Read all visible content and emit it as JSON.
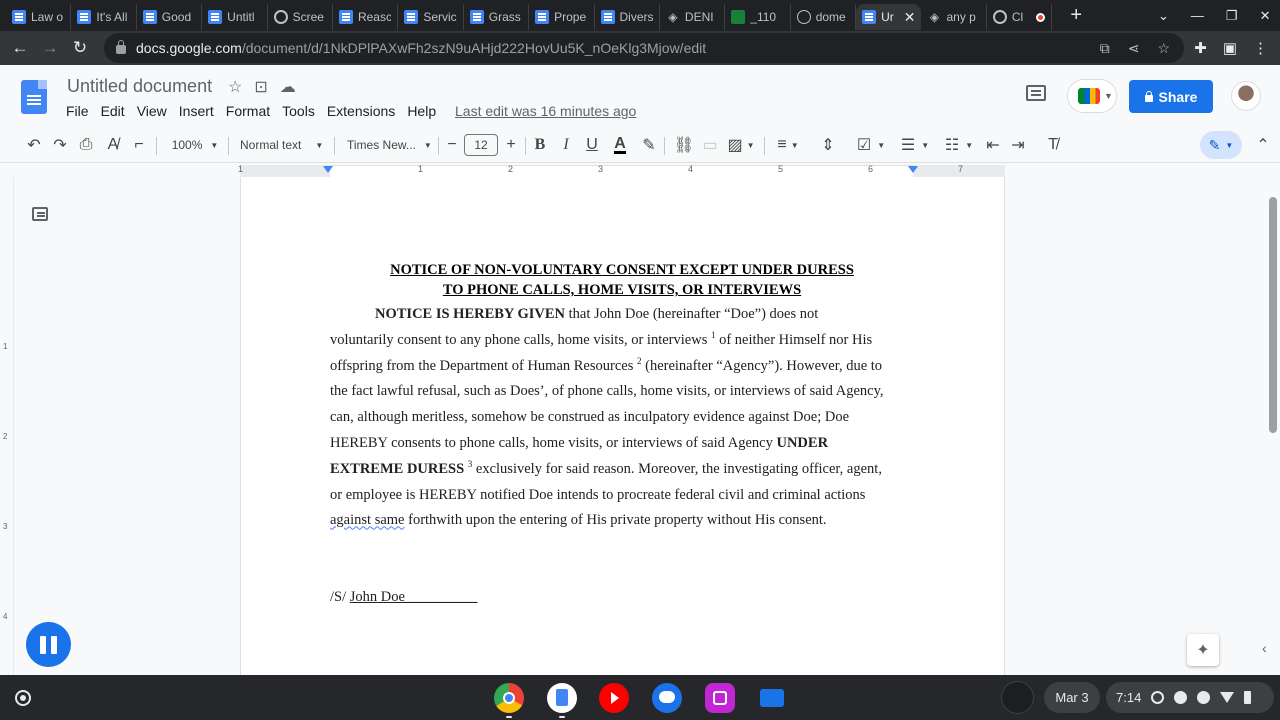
{
  "browser": {
    "tabs": [
      {
        "title": "Law o",
        "favicon": "docs-icon"
      },
      {
        "title": "It's All",
        "favicon": "docs-icon"
      },
      {
        "title": "Good",
        "favicon": "docs-icon"
      },
      {
        "title": "Untitl",
        "favicon": "docs-icon"
      },
      {
        "title": "Scree",
        "favicon": "record-icon"
      },
      {
        "title": "Reasc",
        "favicon": "docs-icon"
      },
      {
        "title": "Servic",
        "favicon": "docs-icon"
      },
      {
        "title": "Grass",
        "favicon": "docs-icon"
      },
      {
        "title": "Prope",
        "favicon": "docs-icon"
      },
      {
        "title": "Divers",
        "favicon": "docs-icon"
      },
      {
        "title": "DENI",
        "favicon": "diamond-icon"
      },
      {
        "title": "_110",
        "favicon": "sheets-icon"
      },
      {
        "title": "dome",
        "favicon": "globe-icon"
      },
      {
        "title": "Ur",
        "favicon": "docs-icon",
        "active": true
      },
      {
        "title": "any p",
        "favicon": "diamond-icon"
      },
      {
        "title": "Cl",
        "favicon": "record-icon"
      }
    ],
    "url_domain": "docs.google.com",
    "url_path": "/document/d/1NkDPlPAXwFh2szN9uAHjd222HovUu5K_nOeKlg3Mjow/edit"
  },
  "docs": {
    "title": "Untitled document",
    "menu": [
      "File",
      "Edit",
      "View",
      "Insert",
      "Format",
      "Tools",
      "Extensions",
      "Help"
    ],
    "last_edit": "Last edit was 16 minutes ago",
    "share_label": "Share",
    "toolbar": {
      "zoom": "100%",
      "style": "Normal text",
      "font": "Times New...",
      "font_size": "12",
      "minus": "−",
      "plus": "+"
    },
    "ruler_numbers": [
      "1",
      "1",
      "2",
      "3",
      "4",
      "5",
      "6",
      "7"
    ],
    "vruler_numbers": [
      "1",
      "2",
      "3",
      "4"
    ]
  },
  "document": {
    "heading_line1": "NOTICE OF NON-VOLUNTARY CONSENT EXCEPT UNDER DURESS",
    "heading_line2": "TO PHONE CALLS, HOME VISITS, OR INTERVIEWS",
    "lines": {
      "l1_bold": "NOTICE IS HEREBY GIVEN",
      "l1_rest": " that John Doe (hereinafter “Doe”) does not",
      "l2_text": "voluntarily consent to any phone calls, home visits, or interviews ",
      "l2_sup": "1",
      "l2_rest": " of neither Himself nor His",
      "l3_text": "offspring from the Department of Human Resources ",
      "l3_sup": "2",
      "l3_rest": "  (hereinafter “Agency”). However, due to",
      "l4": "the fact lawful refusal, such as Does’, of phone calls, home visits, or interviews of said Agency,",
      "l5": "can, although meritless, somehow be construed as inculpatory evidence against Doe; Doe",
      "l6_text": "HEREBY consents to phone calls, home visits, or interviews of said Agency ",
      "l6_bold": "UNDER",
      "l7_bold": "EXTREME DURESS ",
      "l7_sup": "3",
      "l7_rest": " exclusively for said reason. Moreover, the investigating officer, agent,",
      "l8": "or employee is HEREBY notified Doe intends to procreate federal civil and criminal actions",
      "l9_spell": "against same",
      "l9_rest": " forthwith upon the entering of His private property without His consent."
    },
    "signature_prefix": "/S/ ",
    "signature_name": "John Doe__________"
  },
  "shelf": {
    "date": "Mar 3",
    "time": "7:14"
  }
}
